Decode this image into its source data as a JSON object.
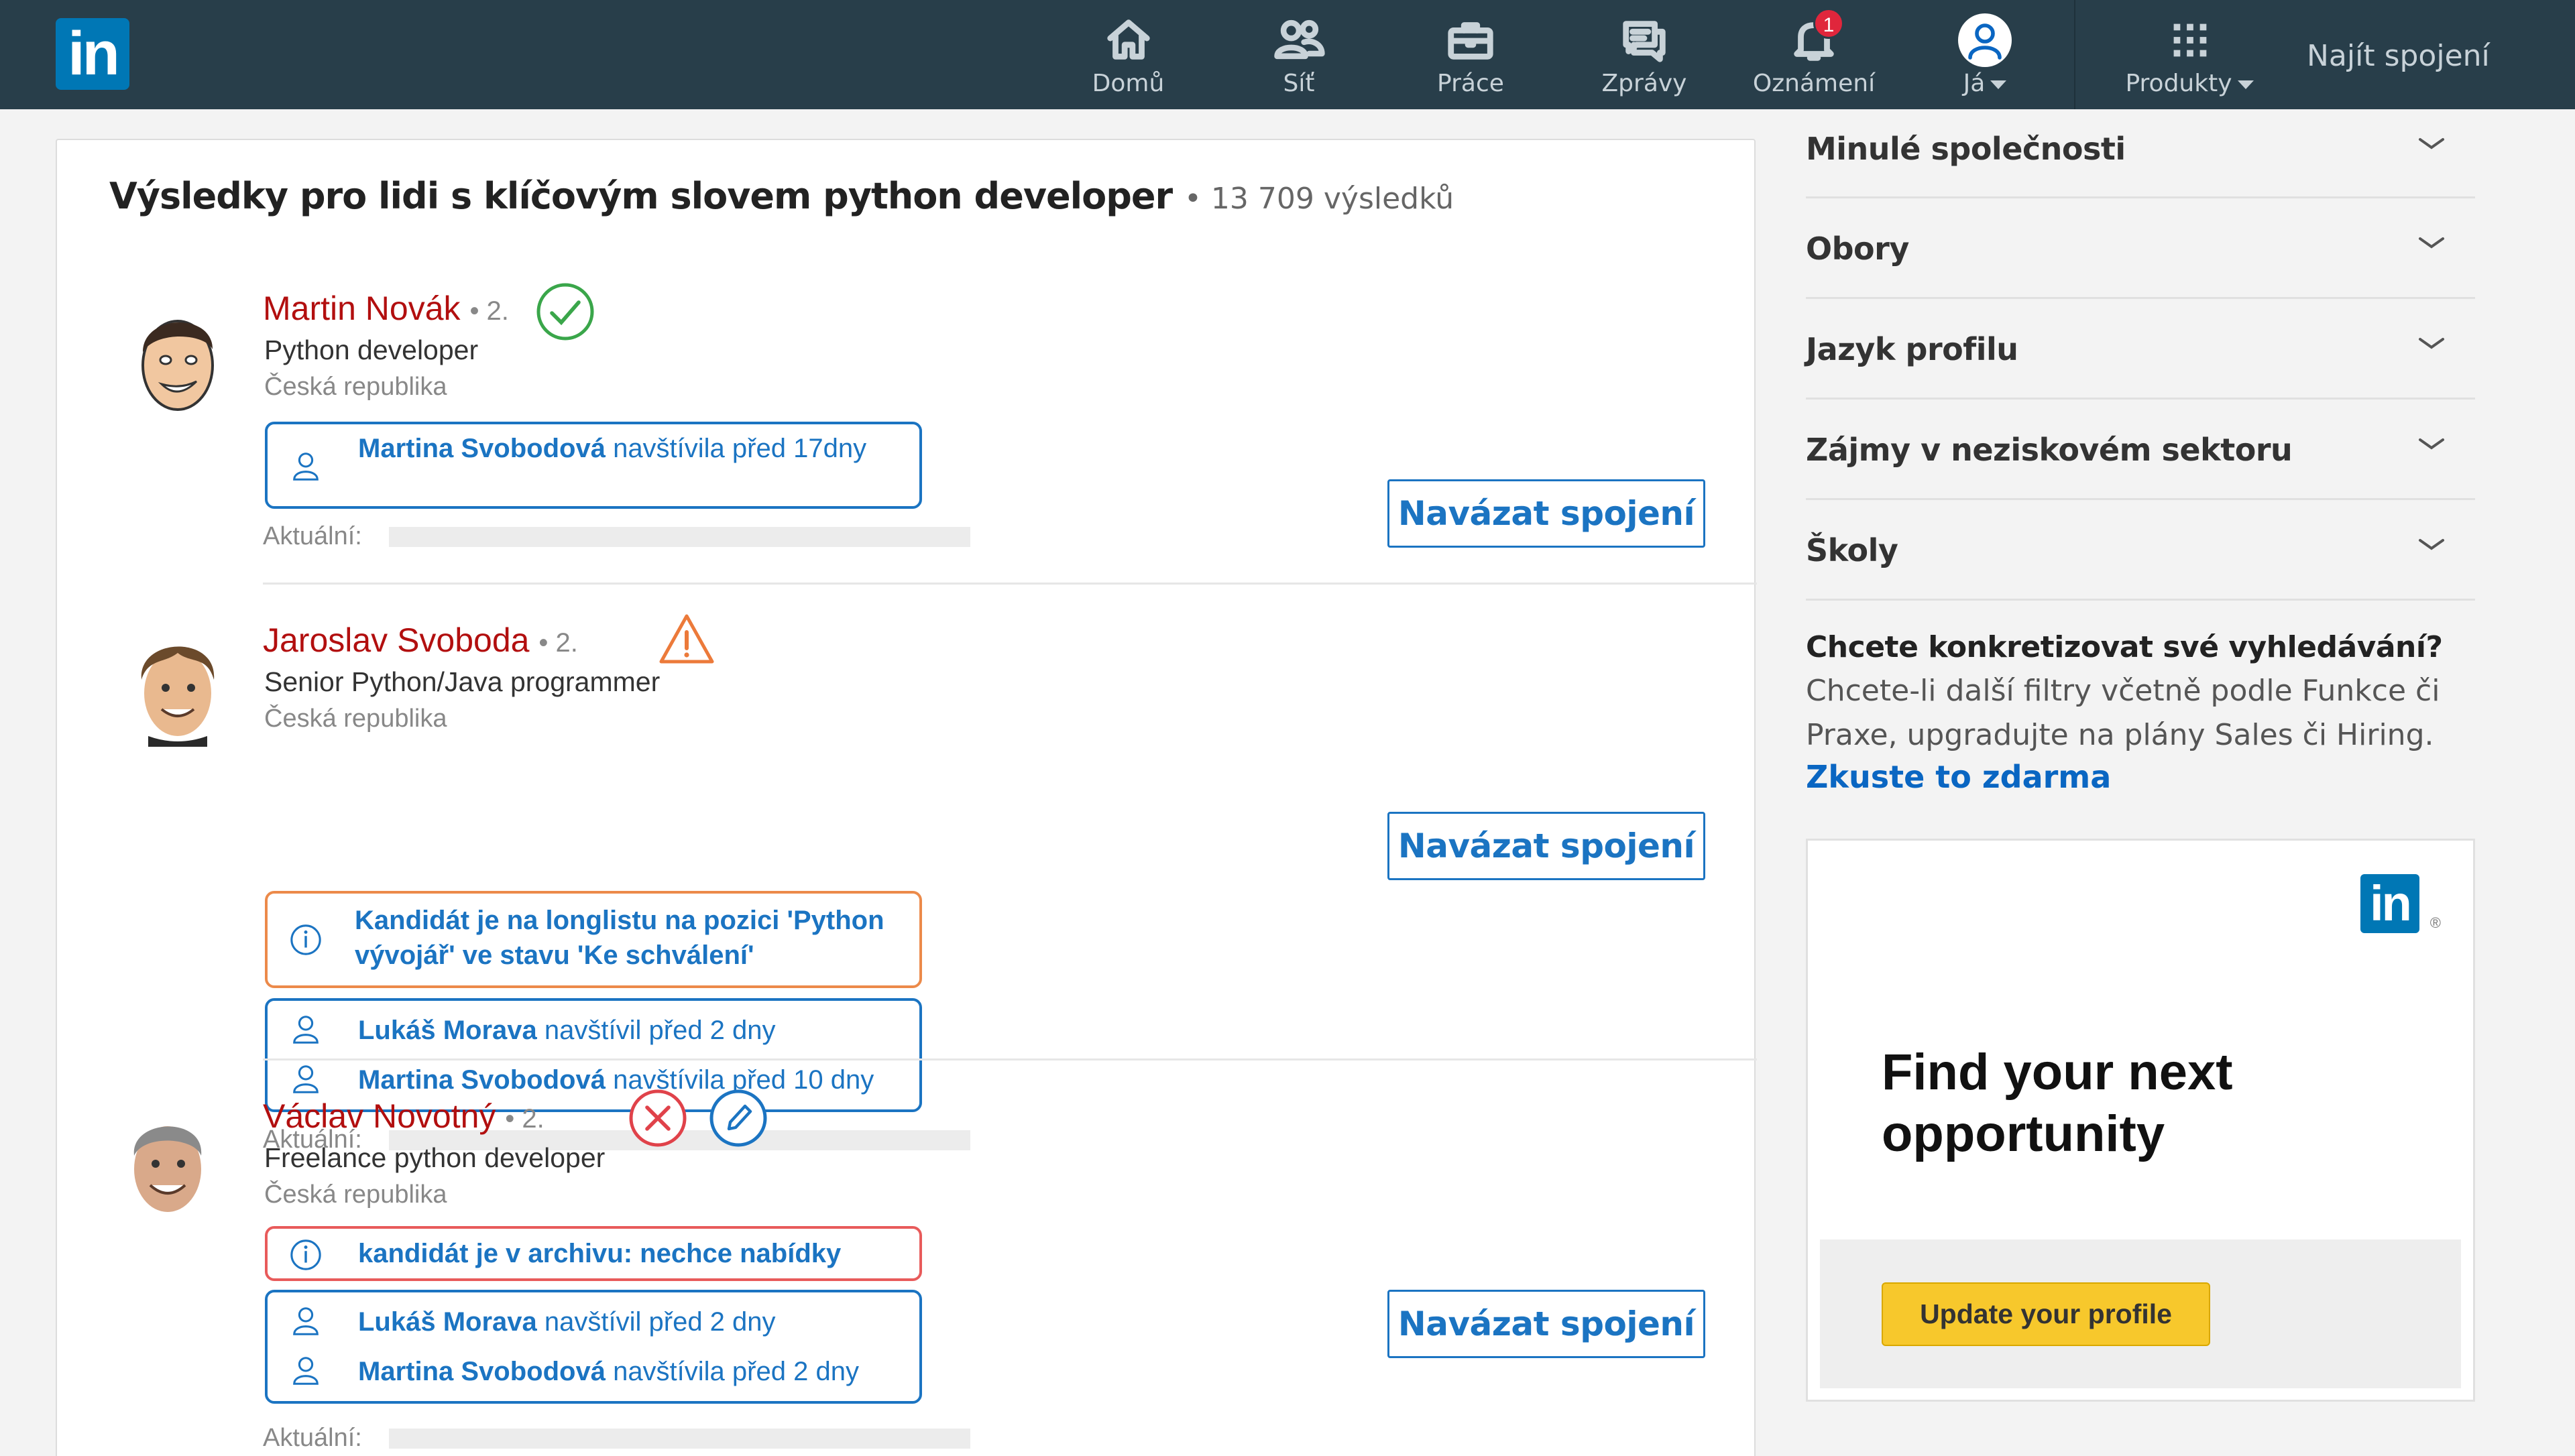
{
  "nav": {
    "logo": "in",
    "items": [
      {
        "label": "Domů",
        "icon": "home-icon"
      },
      {
        "label": "Síť",
        "icon": "network-icon"
      },
      {
        "label": "Práce",
        "icon": "jobs-icon"
      },
      {
        "label": "Zprávy",
        "icon": "messages-icon"
      },
      {
        "label": "Oznámení",
        "icon": "bell-icon",
        "badge": "1"
      },
      {
        "label": "Já",
        "icon": "avatar-icon"
      },
      {
        "label": "Produkty",
        "icon": "grid-icon"
      }
    ],
    "find_connections": "Najít spojení"
  },
  "results": {
    "heading": "Výsledky pro lidi s klíčovým slovem python developer",
    "count": "• 13 709 výsledků"
  },
  "people": [
    {
      "name": "Martin Novák",
      "degree": "• 2.",
      "title": "Python developer",
      "location": "Česká republika",
      "status_icons": [
        "check-circle-icon"
      ],
      "info_box": {
        "visit_person": "Martina Svobodová",
        "visit_text": " navštívila před 17dny"
      },
      "aktualni_label": "Aktuální:",
      "connect_label": "Navázat spojení"
    },
    {
      "name": "Jaroslav Svoboda",
      "degree": "• 2.",
      "title": "Senior Python/Java programmer",
      "location": "Česká republika",
      "status_icons": [
        "warning-triangle-icon"
      ],
      "alert_box": {
        "text": "Kandidát je na longlistu na pozici 'Python vývojář' ve stavu 'Ke schválení'"
      },
      "visits": [
        {
          "person": "Lukáš Morava",
          "text": " navštívil před 2 dny"
        },
        {
          "person": "Martina Svobodová",
          "text": " navštívila před 10 dny"
        }
      ],
      "aktualni_label": "Aktuální:",
      "connect_label": "Navázat spojení"
    },
    {
      "name": "Václav Novotný",
      "degree": "• 2.",
      "title": "Freelance python developer",
      "location": "Česká republika",
      "status_icons": [
        "reject-circle-icon",
        "edit-pencil-icon"
      ],
      "alert_box": {
        "text": "kandidát je v archivu: nechce nabídky"
      },
      "visits": [
        {
          "person": "Lukáš Morava",
          "text": " navštívil před 2 dny"
        },
        {
          "person": "Martina Svobodová",
          "text": " navštívila před 2 dny"
        }
      ],
      "aktualni_label": "Aktuální:",
      "connect_label": "Navázat spojení"
    }
  ],
  "sidebar": {
    "filters": [
      "Minulé společnosti",
      "Obory",
      "Jazyk profilu",
      "Zájmy v neziskovém sektoru",
      "Školy"
    ],
    "upgrade_title": "Chcete konkretizovat své vyhledávání?",
    "upgrade_text": "Chcete-li další filtry včetně podle Funkce či Praxe, upgradujte na plány Sales či Hiring.",
    "upgrade_link": "Zkuste to zdarma"
  },
  "ad": {
    "logo": "in",
    "registered": "®",
    "headline": "Find your next opportunity",
    "button": "Update your profile"
  },
  "colors": {
    "nav_bg": "#283e4a",
    "brand_blue": "#0077b5",
    "link_blue": "#1b74c2",
    "name_red": "#b20f0f",
    "ok_green": "#3aa64a",
    "warn_orange": "#ec8a4a",
    "reject_red": "#e0424a",
    "ad_yellow": "#f7c82c"
  }
}
